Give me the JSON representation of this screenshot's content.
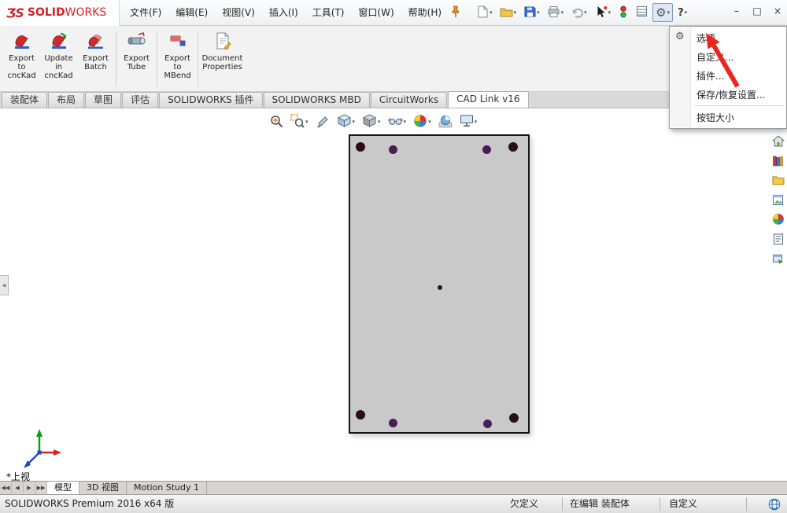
{
  "colors": {
    "brand_red": "#d1232a",
    "part_gray": "#c9c9c9",
    "hole_ring": "#2a0d18",
    "dot_purple": "#4a1e55",
    "annotation_arrow_red": "#e8251f"
  },
  "titlebar": {
    "brand_solid": "SOLID",
    "brand_works": "WORKS",
    "ds_mark": "ƷS",
    "menus": [
      {
        "label": "文件(F)"
      },
      {
        "label": "编辑(E)"
      },
      {
        "label": "视图(V)"
      },
      {
        "label": "插入(I)"
      },
      {
        "label": "工具(T)"
      },
      {
        "label": "窗口(W)"
      },
      {
        "label": "帮助(H)"
      }
    ],
    "gear_glyph": "⚙",
    "help_label": "?",
    "window": {
      "minimize": "–",
      "maximize": "□",
      "close": "×"
    }
  },
  "ribbon": {
    "buttons": [
      {
        "label": "Export\nto\ncncKad"
      },
      {
        "label": "Update\nin\ncncKad"
      },
      {
        "label": "Export\nBatch"
      },
      {
        "label": "Export\nTube"
      },
      {
        "label": "Export\nto\nMBend"
      },
      {
        "label": "Document\nProperties"
      }
    ]
  },
  "commandmanager": {
    "tabs": [
      {
        "label": "装配体"
      },
      {
        "label": "布局"
      },
      {
        "label": "草图"
      },
      {
        "label": "评估"
      },
      {
        "label": "SOLIDWORKS 插件"
      },
      {
        "label": "SOLIDWORKS MBD"
      },
      {
        "label": "CircuitWorks"
      },
      {
        "label": "CAD Link v16",
        "active": true
      }
    ]
  },
  "options_menu": {
    "items": [
      {
        "label": "选项",
        "icon": "gear-icon"
      },
      {
        "label": "自定义..."
      },
      {
        "label": "插件..."
      },
      {
        "label": "保存/恢复设置..."
      },
      {
        "label": "按钮大小"
      }
    ]
  },
  "headsup_icons": [
    "zoom-to-fit",
    "zoom-to-area",
    "section-view",
    "view-orientation",
    "display-style",
    "hide-show-items",
    "edit-appearance",
    "apply-scene",
    "view-settings"
  ],
  "taskpane_icons": [
    "solidworks-resources",
    "design-library",
    "file-explorer",
    "view-palette",
    "appearances-scenes",
    "custom-properties",
    "forum"
  ],
  "viewport": {
    "view_label": "*上视"
  },
  "sheet_tabs": [
    {
      "label": "模型",
      "active": true
    },
    {
      "label": "3D 视图"
    },
    {
      "label": "Motion Study 1"
    }
  ],
  "statusbar": {
    "left": "SOLIDWORKS Premium 2016 x64 版",
    "state": "欠定义",
    "editing": "在编辑 装配体",
    "custom": "自定义"
  }
}
